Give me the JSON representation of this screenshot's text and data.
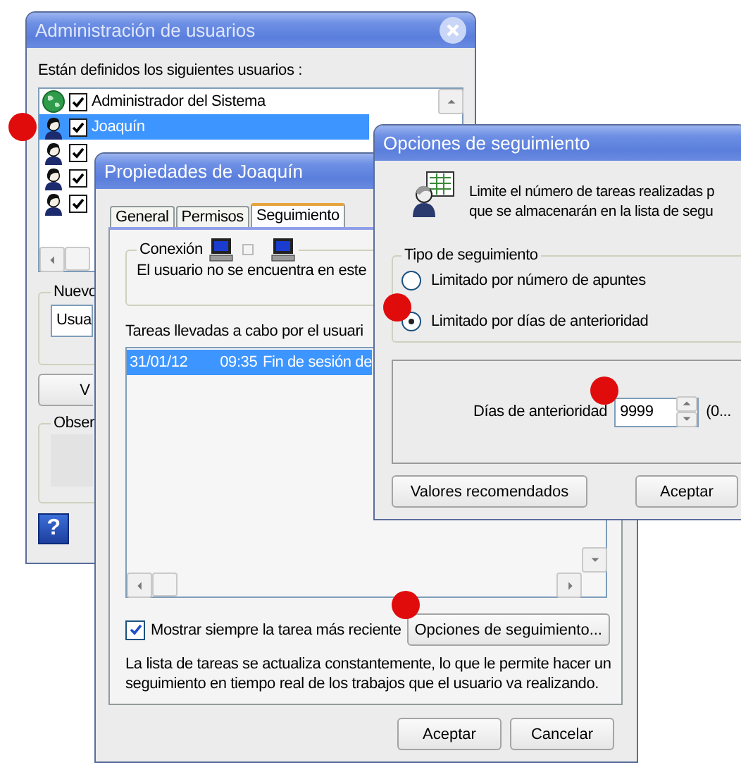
{
  "users_window": {
    "title": "Administración de usuarios",
    "list_label": "Están definidos los siguientes usuarios :",
    "users": [
      {
        "kind": "globe",
        "name": "Administrador del Sistema",
        "checked": true,
        "selected": false
      },
      {
        "kind": "person",
        "name": "Joaquín",
        "checked": true,
        "selected": true
      },
      {
        "kind": "person",
        "checked": true,
        "selected": false
      },
      {
        "kind": "person",
        "checked": true,
        "selected": false
      },
      {
        "kind": "person",
        "checked": true,
        "selected": false
      }
    ],
    "new_group_label": "Nuevo",
    "new_field_value": "Usua",
    "button_label": "V",
    "notes_group_label": "Obser",
    "help_glyph": "?"
  },
  "properties_window": {
    "title": "Propiedades de Joaquín",
    "tabs": [
      {
        "label": "General",
        "selected": false
      },
      {
        "label": "Permisos",
        "selected": false
      },
      {
        "label": "Seguimiento",
        "selected": true
      }
    ],
    "connection_label": "Conexión",
    "connection_status": "El usuario no se encuentra en este",
    "tasks_label": "Tareas llevadas a cabo por el usuari",
    "tasks": [
      {
        "date": "31/01/12",
        "time": "09:35",
        "description": "Fin de sesión de",
        "selected": true
      }
    ],
    "show_latest": {
      "label": "Mostrar siempre la tarea más reciente",
      "checked": true
    },
    "options_button": "Opciones de seguimiento...",
    "info_text": "La lista de tareas se actualiza constantemente, lo que le permite hacer un seguimiento en tiempo real de los trabajos que el usuario va realizando.",
    "buttons": [
      "Aceptar",
      "Cancelar"
    ]
  },
  "tracking_window": {
    "title": "Opciones de seguimiento",
    "description_lines": [
      "Limite el número de tareas realizadas p",
      "que se almacenarán en la lista de segu"
    ],
    "type_group_label": "Tipo de seguimiento",
    "options": [
      {
        "label": "Limitado por número de apuntes",
        "selected": false
      },
      {
        "label": "Limitado por días de anterioridad",
        "selected": true
      }
    ],
    "days_label": "Días de anterioridad",
    "days_value": "9999",
    "range_text": "(0...",
    "buttons": [
      "Valores recomendados",
      "Aceptar"
    ]
  }
}
